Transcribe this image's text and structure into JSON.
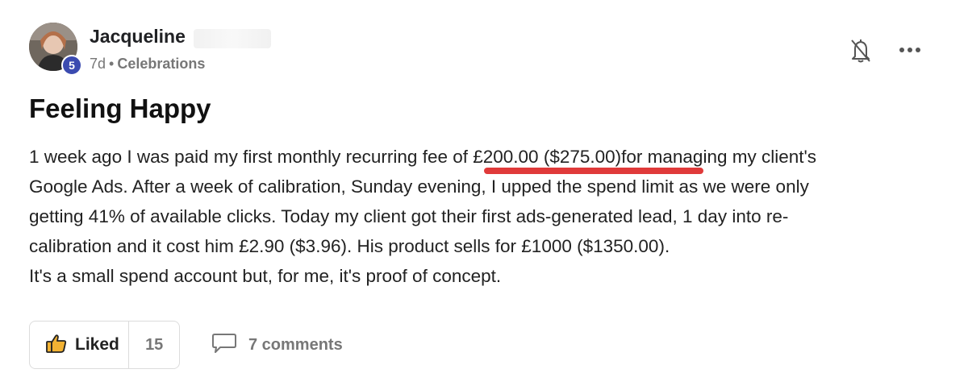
{
  "author": {
    "name": "Jacqueline",
    "level": "5",
    "age": "7d",
    "separator": "•",
    "category": "Celebrations"
  },
  "post": {
    "title": "Feeling Happy",
    "lines": [
      "1 week ago I was paid my first monthly recurring fee of £200.00 ($275.00)for managing my client's",
      "Google Ads. After a week of calibration, Sunday evening, I upped the spend limit as we were only",
      "getting 41% of available clicks. Today my client got their first ads-generated lead, 1 day into re-",
      "calibration and it cost him £2.90 ($3.96). His product sells for £1000 ($1350.00).",
      "It's a small spend account but, for me, it's proof of concept."
    ]
  },
  "actions": {
    "like_label": "Liked",
    "like_count": "15",
    "comments_label": "7 comments"
  },
  "icons": {
    "bell": "bell-off-icon",
    "more": "more-horizontal-icon",
    "like": "thumbs-up-icon",
    "comment": "comment-icon"
  },
  "colors": {
    "badge": "#3b4bb0",
    "highlight_underline": "#e03a3a",
    "like_icon": "#f2b233"
  }
}
